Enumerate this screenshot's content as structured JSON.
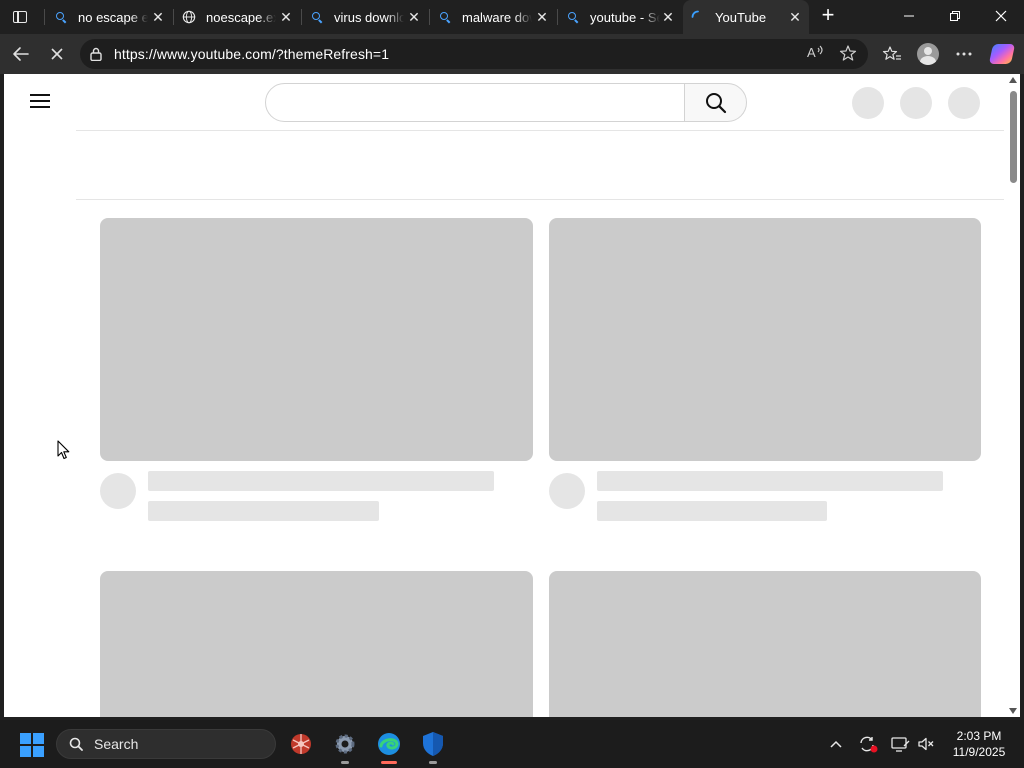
{
  "browser": {
    "tabs": [
      {
        "title": "no escape ex",
        "icon": "search-icon"
      },
      {
        "title": "noescape.exe",
        "icon": "globe-icon"
      },
      {
        "title": "virus downlo",
        "icon": "search-icon"
      },
      {
        "title": "malware dow",
        "icon": "search-icon"
      },
      {
        "title": "youtube - Se",
        "icon": "search-icon"
      },
      {
        "title": "YouTube",
        "icon": "loading-spinner-icon",
        "active": true
      }
    ],
    "new_tab_label": "+",
    "url": "https://www.youtube.com/?themeRefresh=1",
    "window_controls": {
      "minimize": "—",
      "restore": "❐",
      "close": "✕"
    }
  },
  "youtube": {
    "search_placeholder": "",
    "loading": true
  },
  "taskbar": {
    "search_label": "Search",
    "time": "2:03 PM",
    "date": "11/9/2025"
  },
  "colors": {
    "accent": "#3aa0ff",
    "skeleton_thumb": "#cbcbcb",
    "skeleton_line": "#e5e5e5"
  }
}
